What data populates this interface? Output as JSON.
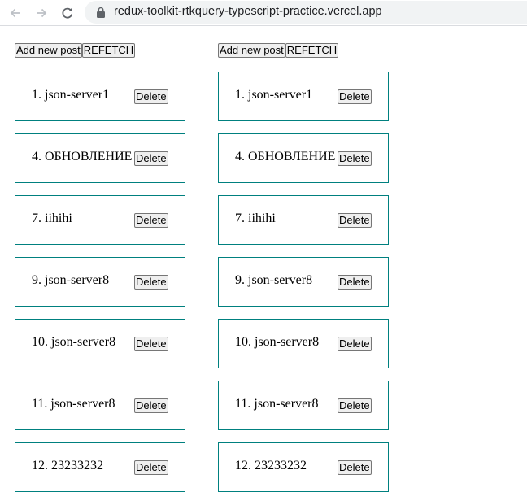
{
  "browser": {
    "url": "redux-toolkit-rtkquery-typescript-practice.vercel.app",
    "icons": [
      "back-arrow-icon",
      "forward-arrow-icon",
      "reload-icon",
      "lock-icon"
    ]
  },
  "columns": [
    {
      "toolbar": {
        "add_label": "Add new post",
        "refetch_label": "REFETCH"
      },
      "posts": [
        {
          "title": "1. json-server1",
          "delete_label": "Delete"
        },
        {
          "title": "4. ОБНОВЛЕНИЕ",
          "delete_label": "Delete"
        },
        {
          "title": "7. iihihi",
          "delete_label": "Delete"
        },
        {
          "title": "9. json-server8",
          "delete_label": "Delete"
        },
        {
          "title": "10. json-server8",
          "delete_label": "Delete"
        },
        {
          "title": "11. json-server8",
          "delete_label": "Delete"
        },
        {
          "title": "12. 23233232",
          "delete_label": "Delete"
        }
      ]
    },
    {
      "toolbar": {
        "add_label": "Add new post",
        "refetch_label": "REFETCH"
      },
      "posts": [
        {
          "title": "1. json-server1",
          "delete_label": "Delete"
        },
        {
          "title": "4. ОБНОВЛЕНИЕ",
          "delete_label": "Delete"
        },
        {
          "title": "7. iihihi",
          "delete_label": "Delete"
        },
        {
          "title": "9. json-server8",
          "delete_label": "Delete"
        },
        {
          "title": "10. json-server8",
          "delete_label": "Delete"
        },
        {
          "title": "11. json-server8",
          "delete_label": "Delete"
        },
        {
          "title": "12. 23233232",
          "delete_label": "Delete"
        }
      ]
    }
  ]
}
